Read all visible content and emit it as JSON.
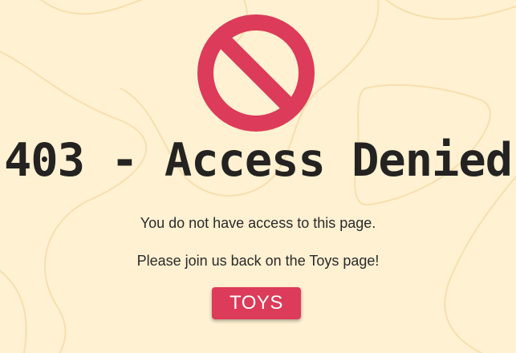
{
  "error": {
    "title": "403 - Access Denied",
    "message_line_1": "You do not have access to this page.",
    "message_line_2": "Please join us back on the Toys page!",
    "icon": "forbidden-icon"
  },
  "actions": {
    "toys_button_label": "TOYS"
  },
  "colors": {
    "background": "#fff1d2",
    "accent": "#dc3b5a",
    "text": "#242321"
  }
}
